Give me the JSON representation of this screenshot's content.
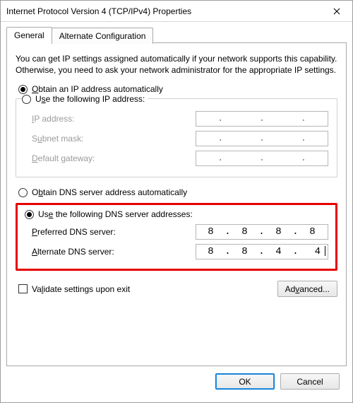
{
  "window": {
    "title": "Internet Protocol Version 4 (TCP/IPv4) Properties"
  },
  "tabs": {
    "general": "General",
    "alternate": "Alternate Configuration"
  },
  "intro": "You can get IP settings assigned automatically if your network supports this capability. Otherwise, you need to ask your network administrator for the appropriate IP settings.",
  "ip": {
    "radio_auto": "btain an IP address automatically",
    "radio_auto_u": "O",
    "radio_manual_pre": "U",
    "radio_manual_u": "s",
    "radio_manual_post": "e the following IP address:",
    "label_ip_u": "I",
    "label_ip": "P address:",
    "label_subnet": "S",
    "label_subnet_u": "u",
    "label_subnet_post": "bnet mask:",
    "label_gw_u": "D",
    "label_gw": "efault gateway:",
    "value_ip": "",
    "value_subnet": "",
    "value_gw": ""
  },
  "dns": {
    "radio_auto_pre": "O",
    "radio_auto_u": "b",
    "radio_auto_post": "tain DNS server address automatically",
    "radio_manual_pre": "Us",
    "radio_manual_u": "e",
    "radio_manual_post": " the following DNS server addresses:",
    "label_pref_u": "P",
    "label_pref": "referred DNS server:",
    "label_alt_u": "A",
    "label_alt": "lternate DNS server:",
    "pref_octets": [
      "8",
      "8",
      "8",
      "8"
    ],
    "alt_octets": [
      "8",
      "8",
      "4",
      "4"
    ]
  },
  "validate": {
    "pre": "Va",
    "u": "l",
    "post": "idate settings upon exit"
  },
  "buttons": {
    "advanced_pre": "Ad",
    "advanced_u": "v",
    "advanced_post": "anced...",
    "ok": "OK",
    "cancel": "Cancel"
  }
}
